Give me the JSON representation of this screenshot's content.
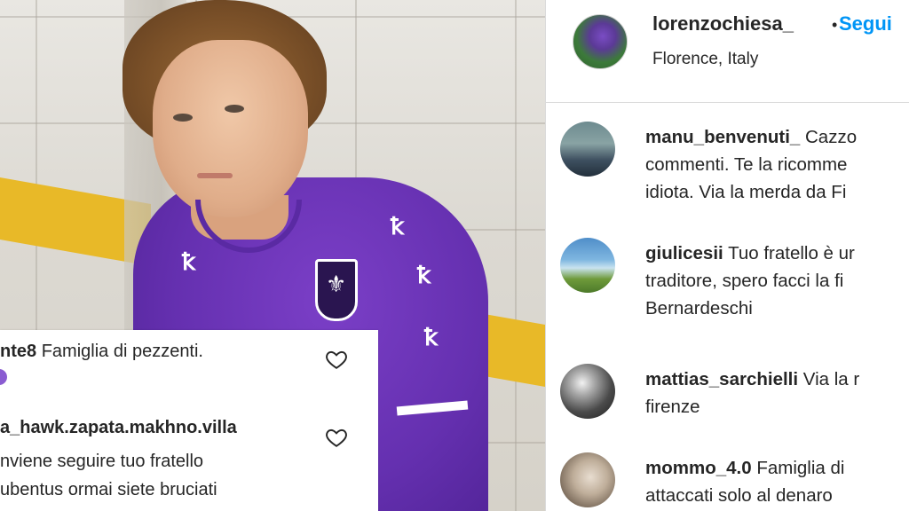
{
  "post": {
    "author": {
      "username": "lorenzochiesa_",
      "separator": "•",
      "follow_label": "Segui",
      "location": "Florence, Italy"
    }
  },
  "photo": {
    "brand_marks": [
      "Kappa",
      "Kappa",
      "Kappa",
      "Kappa"
    ]
  },
  "overlay_comments": [
    {
      "username": "nte8",
      "text": "Famiglia di pezzenti."
    },
    {
      "username": "a_hawk.zapata.makhno.villa",
      "lines": [
        "nviene seguire tuo fratello",
        "ubentus ormai siete bruciati"
      ]
    }
  ],
  "comments": [
    {
      "username": "manu_benvenuti_",
      "lines": [
        "Cazzo",
        "commenti. Te la ricomme",
        "idiota. Via la merda da Fi"
      ]
    },
    {
      "username": "giulicesii",
      "lines": [
        "Tuo fratello è ur",
        "traditore, spero facci la fi",
        "Bernardeschi"
      ]
    },
    {
      "username": "mattias_sarchielli",
      "lines": [
        "Via la r",
        "firenze"
      ]
    },
    {
      "username": "mommo_4.0",
      "lines": [
        "Famiglia di",
        "attaccati solo al denaro"
      ]
    }
  ],
  "colors": {
    "link_blue": "#0095f6",
    "text": "#262626",
    "divider": "#dbdbdb",
    "shirt_purple": "#6530b0"
  },
  "icons": [
    "heart-outline-icon",
    "heart-outline-icon"
  ]
}
